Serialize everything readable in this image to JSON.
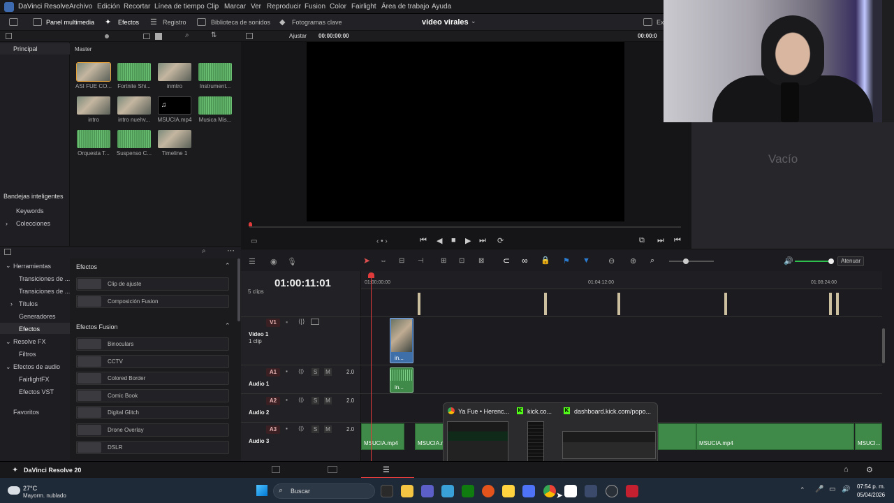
{
  "app": {
    "name": "DaVinci Resolve",
    "project_title": "video virales"
  },
  "menu": [
    "Archivo",
    "Edición",
    "Recortar",
    "Línea de tiempo",
    "Clip",
    "Marcar",
    "Ver",
    "Reproducir",
    "Fusion",
    "Color",
    "Fairlight",
    "Área de trabajo",
    "Ayuda"
  ],
  "toolbar": {
    "media_pool": "Panel multimedia",
    "effects": "Efectos",
    "log": "Registro",
    "sound_library": "Biblioteca de sonidos",
    "keyframes": "Fotogramas clave",
    "export": "Ex"
  },
  "viewer": {
    "fit": "Ajustar",
    "timecode_left": "00:00:00:00",
    "timecode_right": "00:00:0"
  },
  "left_nav": {
    "principal": "Principal",
    "smart_bins": "Bandejas inteligentes",
    "keywords": "Keywords",
    "collections": "Colecciones"
  },
  "bin": {
    "title": "Master",
    "clips": [
      {
        "name": "ASI FUE CO...",
        "kind": "vid"
      },
      {
        "name": "Fortnite Shi...",
        "kind": "aud"
      },
      {
        "name": "inmtro",
        "kind": "vid"
      },
      {
        "name": "Instrument...",
        "kind": "aud"
      },
      {
        "name": "intro",
        "kind": "vid"
      },
      {
        "name": "intro nuehv...",
        "kind": "vid"
      },
      {
        "name": "MSUCIA.mp4",
        "kind": "blk"
      },
      {
        "name": "Musica Mis...",
        "kind": "aud"
      },
      {
        "name": "Orquesta T...",
        "kind": "aud"
      },
      {
        "name": "Suspenso C...",
        "kind": "aud"
      },
      {
        "name": "Timeline 1",
        "kind": "vid"
      }
    ]
  },
  "right_panel": {
    "empty": "Vacío"
  },
  "tools_tree": {
    "herramientas": "Herramientas",
    "transiciones_video": "Transiciones de ...",
    "transiciones_audio": "Transiciones de ...",
    "titulos": "Títulos",
    "generadores": "Generadores",
    "efectos": "Efectos",
    "resolve_fx": "Resolve FX",
    "filtros": "Filtros",
    "efectos_audio": "Efectos de audio",
    "fairlightfx": "FairlightFX",
    "efectos_vst": "Efectos VST",
    "favoritos": "Favoritos"
  },
  "effects": {
    "header": "Efectos",
    "items": [
      "Clip de ajuste",
      "Composición Fusion"
    ],
    "fusion_header": "Efectos Fusion",
    "fusion_items": [
      "Binoculars",
      "CCTV",
      "Colored Border",
      "Comic Book",
      "Digital Glitch",
      "Drone Overlay",
      "DSLR"
    ]
  },
  "timeline": {
    "timecode": "01:00:11:01",
    "ruler": [
      "01:00:00:00",
      "01:04:12:00",
      "01:08:24:00"
    ],
    "clips_count": "5 clips",
    "tracks": [
      {
        "tag": "V1",
        "name": "Video 1",
        "sub": "1 clip",
        "level": ""
      },
      {
        "tag": "A1",
        "name": "Audio 1",
        "sub": "",
        "level": "2.0"
      },
      {
        "tag": "A2",
        "name": "Audio 2",
        "sub": "",
        "level": "2.0"
      },
      {
        "tag": "A3",
        "name": "Audio 3",
        "sub": "",
        "level": "2.0"
      }
    ],
    "v1_clip": "in...",
    "a1_clip": "in...",
    "a3_clips": [
      "MSUCIA.mp4",
      "MSUCIA.m",
      "MSUCIA.mp4",
      "MSUCI..."
    ],
    "mute_label": "Atenuar"
  },
  "popup": {
    "items": [
      "Ya Fue • Herenc...",
      "kick.co...",
      "dashboard.kick.com/popo..."
    ]
  },
  "footer": {
    "app": "DaVinci Resolve 20"
  },
  "taskbar": {
    "weather_temp": "27°C",
    "weather_desc": "Mayorm. nublado",
    "search": "Buscar",
    "time": "07:54 p. m.",
    "date": "05/04/2026"
  }
}
